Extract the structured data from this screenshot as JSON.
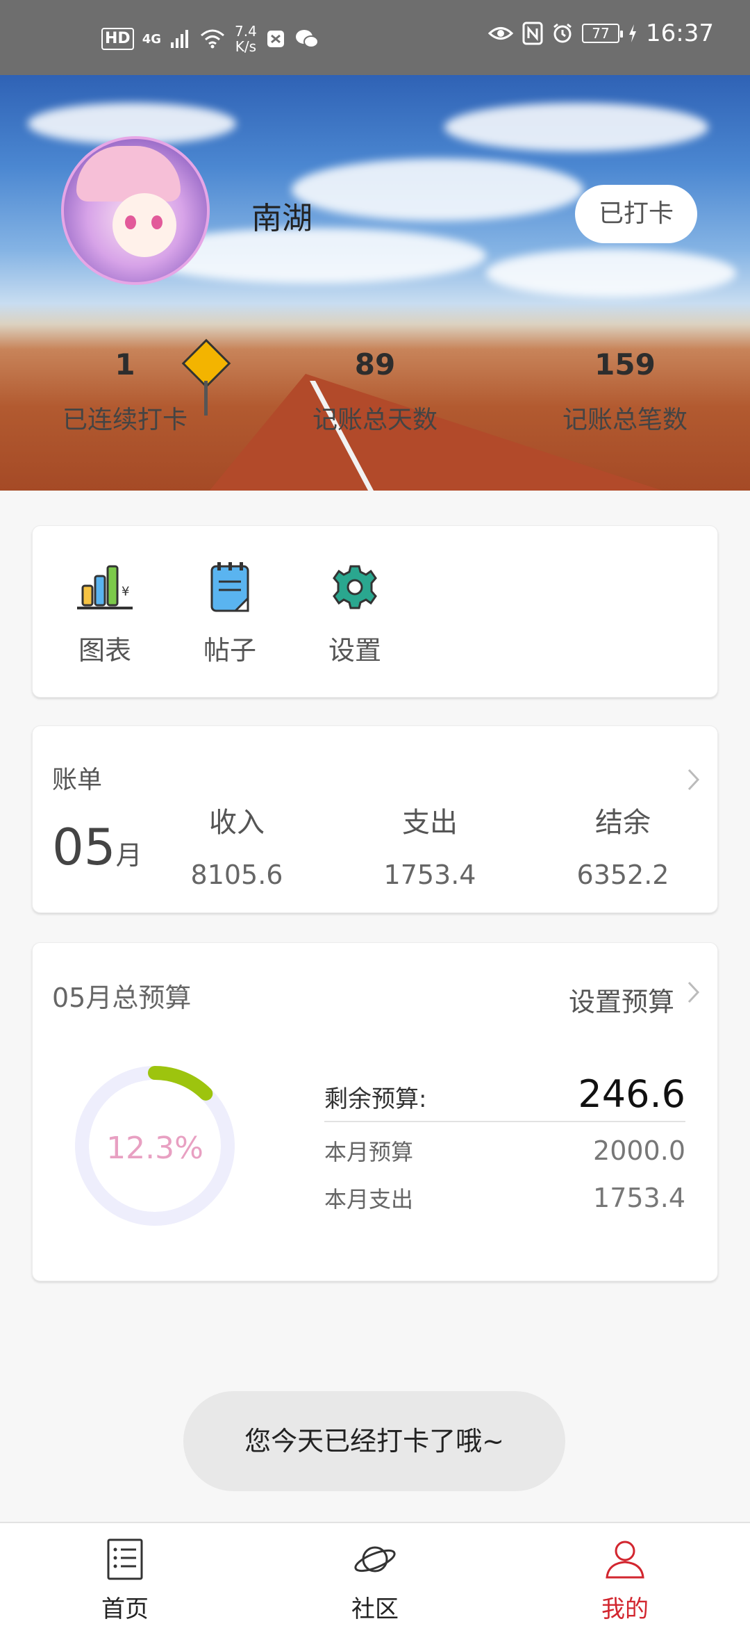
{
  "status_bar": {
    "hd": "HD",
    "network": "4G",
    "speed_value": "7.4",
    "speed_unit": "K/s",
    "battery": "77",
    "time": "16:37"
  },
  "profile": {
    "username": "南湖",
    "checkin_button": "已打卡",
    "stats": [
      {
        "value": "1",
        "label": "已连续打卡"
      },
      {
        "value": "89",
        "label": "记账总天数"
      },
      {
        "value": "159",
        "label": "记账总笔数"
      }
    ]
  },
  "menu": {
    "items": [
      {
        "label": "图表",
        "icon": "bar-chart-icon"
      },
      {
        "label": "帖子",
        "icon": "notepad-icon"
      },
      {
        "label": "设置",
        "icon": "gear-icon"
      }
    ]
  },
  "bill": {
    "title": "账单",
    "month_num": "05",
    "month_unit": "月",
    "columns": [
      {
        "label": "收入",
        "value": "8105.6"
      },
      {
        "label": "支出",
        "value": "1753.4"
      },
      {
        "label": "结余",
        "value": "6352.2"
      }
    ]
  },
  "budget": {
    "title": "05月总预算",
    "set_label": "设置预算",
    "percent_text": "12.3%",
    "percent_fraction": 0.123,
    "remaining_label": "剩余预算:",
    "remaining_value": "246.6",
    "month_budget_label": "本月预算",
    "month_budget_value": "2000.0",
    "month_expense_label": "本月支出",
    "month_expense_value": "1753.4",
    "ring_track_color": "#eeeefc",
    "ring_fill_color": "#9dc40e"
  },
  "toast": {
    "text": "您今天已经打卡了哦~"
  },
  "bottom_nav": {
    "items": [
      {
        "label": "首页",
        "icon": "list-document-icon",
        "active": false
      },
      {
        "label": "社区",
        "icon": "planet-icon",
        "active": false
      },
      {
        "label": "我的",
        "icon": "person-icon",
        "active": true
      }
    ]
  },
  "colors": {
    "accent_active": "#d2262f",
    "status_bar": "#6e6e6e"
  }
}
